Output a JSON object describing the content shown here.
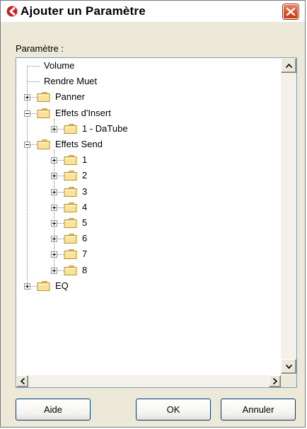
{
  "window": {
    "title": "Ajouter un Paramètre",
    "accent_color": "#cc2222",
    "close_icon": "close-icon"
  },
  "param_label": "Paramètre :",
  "tree": {
    "items": [
      {
        "label": "Volume",
        "level": 0,
        "expander": "none",
        "icon": "none"
      },
      {
        "label": "Rendre Muet",
        "level": 0,
        "expander": "none",
        "icon": "none"
      },
      {
        "label": "Panner",
        "level": 0,
        "expander": "plus",
        "icon": "folder-icon"
      },
      {
        "label": "Effets d'Insert",
        "level": 0,
        "expander": "minus",
        "icon": "folder-icon"
      },
      {
        "label": "1 - DaTube",
        "level": 1,
        "expander": "plus",
        "icon": "folder-icon"
      },
      {
        "label": "Effets Send",
        "level": 0,
        "expander": "minus",
        "icon": "folder-icon"
      },
      {
        "label": "1",
        "level": 1,
        "expander": "plus",
        "icon": "folder-icon"
      },
      {
        "label": "2",
        "level": 1,
        "expander": "plus",
        "icon": "folder-icon"
      },
      {
        "label": "3",
        "level": 1,
        "expander": "plus",
        "icon": "folder-icon"
      },
      {
        "label": "4",
        "level": 1,
        "expander": "plus",
        "icon": "folder-icon"
      },
      {
        "label": "5",
        "level": 1,
        "expander": "plus",
        "icon": "folder-icon"
      },
      {
        "label": "6",
        "level": 1,
        "expander": "plus",
        "icon": "folder-icon"
      },
      {
        "label": "7",
        "level": 1,
        "expander": "plus",
        "icon": "folder-icon"
      },
      {
        "label": "8",
        "level": 1,
        "expander": "plus",
        "icon": "folder-icon"
      },
      {
        "label": "EQ",
        "level": 0,
        "expander": "plus",
        "icon": "folder-icon"
      }
    ]
  },
  "buttons": {
    "help": "Aide",
    "ok": "OK",
    "cancel": "Annuler"
  }
}
